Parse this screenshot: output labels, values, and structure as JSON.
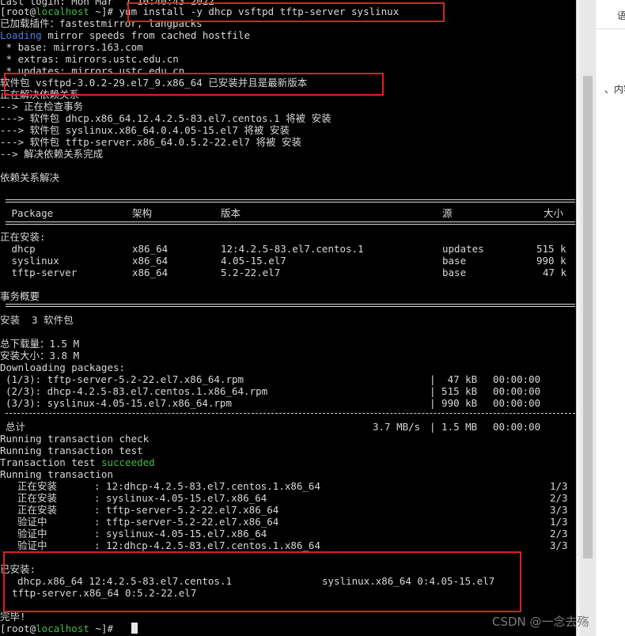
{
  "terminal": {
    "top_partial": "Last login: Mon Mar  7 10:40:43 2022",
    "prompt_user": "[root@",
    "prompt_host": "localhost",
    "prompt_path": " ~]# ",
    "command": "yum install -y dhcp vsftpd tftp-server syslinux",
    "lines_a": [
      "已加载插件：fastestmirror, langpacks"
    ],
    "loading_word": "Loading",
    "loading_rest": " mirror speeds from cached hostfile",
    "mirrors": [
      " * base: mirrors.163.com",
      " * extras: mirrors.ustc.edu.cn",
      " * updates: mirrors.ustc.edu.cn"
    ],
    "vsftpd_line": "软件包 vsftpd-3.0.2-29.el7_9.x86_64 已安装并且是最新版本",
    "resolve": [
      "正在解决依赖关系",
      "--> 正在检查事务",
      "---> 软件包 dhcp.x86_64.12.4.2.5-83.el7.centos.1 将被 安装",
      "---> 软件包 syslinux.x86_64.0.4.05-15.el7 将被 安装",
      "---> 软件包 tftp-server.x86_64.0.5.2-22.el7 将被 安装",
      "--> 解决依赖关系完成"
    ],
    "deps_resolved": "依赖关系解决",
    "table_headers": {
      "package": " Package",
      "arch": "架构",
      "version": "版本",
      "repo": "源",
      "size": "大小"
    },
    "installing_label": "正在安装:",
    "packages": [
      {
        "name": " dhcp",
        "arch": "x86_64",
        "version": "12:4.2.5-83.el7.centos.1",
        "repo": "updates",
        "size": "515 k"
      },
      {
        "name": " syslinux",
        "arch": "x86_64",
        "version": "4.05-15.el7",
        "repo": "base",
        "size": "990 k"
      },
      {
        "name": " tftp-server",
        "arch": "x86_64",
        "version": "5.2-22.el7",
        "repo": "base",
        "size": "47 k"
      }
    ],
    "summary_label": "事务概要",
    "install_count": "安装  3 软件包",
    "total_download": "总下载量：1.5 M",
    "install_size": "安装大小：3.8 M",
    "downloading": "Downloading packages:",
    "downloads": [
      {
        "file": "(1/3): tftp-server-5.2-22.el7.x86_64.rpm",
        "size": "|  47 kB",
        "time": "00:00:00"
      },
      {
        "file": "(2/3): dhcp-4.2.5-83.el7.centos.1.x86_64.rpm",
        "size": "| 515 kB",
        "time": "00:00:00"
      },
      {
        "file": "(3/3): syslinux-4.05-15.el7.x86_64.rpm",
        "size": "| 990 kB",
        "time": "00:00:00"
      }
    ],
    "total_label": "总计",
    "total_speed": "3.7 MB/s",
    "total_size": "| 1.5 MB",
    "total_time": "00:00:00",
    "trans_check": "Running transaction check",
    "trans_test": "Running transaction test",
    "trans_test_result_prefix": "Transaction test ",
    "trans_test_result": "succeeded",
    "running": "Running transaction",
    "steps": [
      {
        "action": "  正在安装",
        "item": ": 12:dhcp-4.2.5-83.el7.centos.1.x86_64",
        "progress": "1/3"
      },
      {
        "action": "  正在安装",
        "item": ": syslinux-4.05-15.el7.x86_64",
        "progress": "2/3"
      },
      {
        "action": "  正在安装",
        "item": ": tftp-server-5.2-22.el7.x86_64",
        "progress": "3/3"
      },
      {
        "action": "  验证中",
        "item": ": tftp-server-5.2-22.el7.x86_64",
        "progress": "1/3"
      },
      {
        "action": "  验证中",
        "item": ": syslinux-4.05-15.el7.x86_64",
        "progress": "2/3"
      },
      {
        "action": "  验证中",
        "item": ": 12:dhcp-4.2.5-83.el7.centos.1.x86_64",
        "progress": "3/3"
      }
    ],
    "installed_label": "已安装:",
    "installed_a": "  dhcp.x86_64 12:4.2.5-83.el7.centos.1",
    "installed_b": "syslinux.x86_64 0:4.05-15.el7",
    "installed_c": "  tftp-server.x86_64 0:5.2-22.el7",
    "done": "完毕!",
    "final_prompt_path": " ~]# "
  },
  "side": {
    "top_text": "语",
    "mid_text": "、内容"
  },
  "watermark": "CSDN @一念去殇",
  "colors": {
    "background": "#000000",
    "text": "#d8d8d8",
    "green": "#3fbf3f",
    "blue": "#4f7fe0",
    "highlight": "#e02020"
  }
}
